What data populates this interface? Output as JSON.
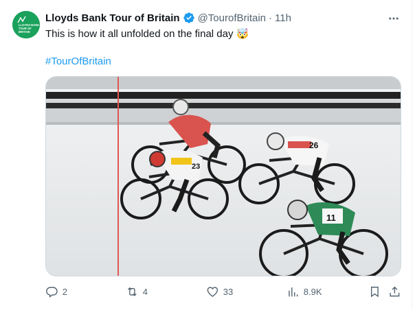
{
  "author": {
    "display_name": "Lloyds Bank Tour of Britain",
    "handle": "@TourofBritain",
    "time": "11h",
    "separator": "·",
    "avatar_brand_color": "#1aa15c",
    "avatar_text": [
      "LLOYDS BANK",
      "TOUR OF",
      "BRITAIN"
    ]
  },
  "tweet": {
    "text": "This is how it all unfolded on the final day 🤯",
    "hashtag": "#TourOfBritain",
    "media_alt": "Photo-finish image of cyclists crossing the finish line"
  },
  "stats": {
    "replies": "2",
    "reposts": "4",
    "likes": "33",
    "views": "8.9K"
  },
  "media_labels": {
    "rider_front": "23",
    "rider_top": "26",
    "rider_right": "11"
  },
  "icons": {
    "more": "more-dots-icon",
    "verified": "verified-badge-icon",
    "reply": "reply-icon",
    "repost": "repost-icon",
    "like": "heart-icon",
    "views": "views-bar-chart-icon",
    "bookmark": "bookmark-icon",
    "share": "share-icon"
  },
  "colors": {
    "link": "#1d9bf0",
    "secondary_text": "#536471",
    "verified": "#1d9bf0"
  }
}
